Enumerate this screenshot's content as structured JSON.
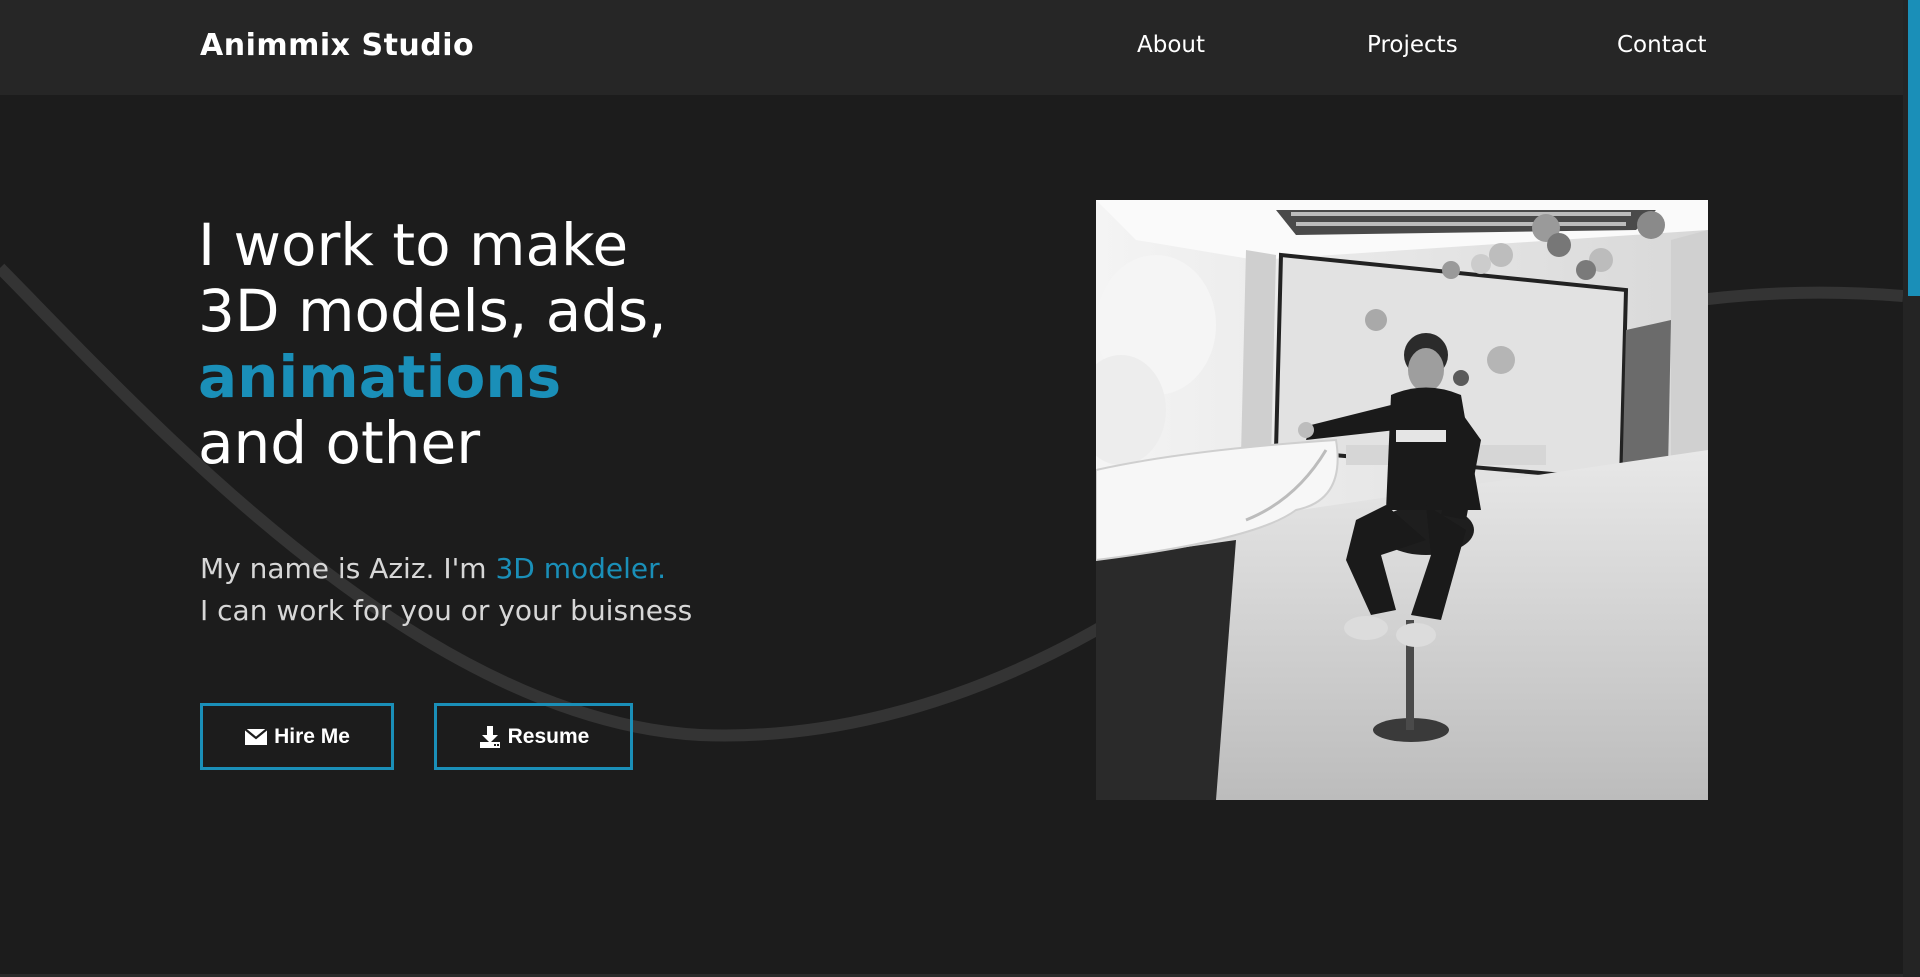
{
  "header": {
    "logo": "Animmix Studio",
    "nav": {
      "about": "About",
      "projects": "Projects",
      "contact": "Contact"
    }
  },
  "hero": {
    "heading": {
      "line1": "I work to make",
      "line2": "3D models, ads,",
      "line3": "animations",
      "line4": "and other"
    },
    "intro": {
      "line1_text": "My name is Aziz. I'm",
      "line1_accent": "3D modeler.",
      "line2": "I can work for you or your buisness"
    },
    "buttons": {
      "hire": "Hire Me",
      "resume": "Resume"
    },
    "photo_alt": "Portrait photo"
  },
  "icons": {
    "hire": "envelope-icon",
    "resume": "download-icon"
  },
  "colors": {
    "background": "#1c1c1c",
    "navbar": "#262626",
    "accent": "#1a8fb8",
    "text": "#ffffff",
    "muted_text": "#d7d7d7"
  }
}
